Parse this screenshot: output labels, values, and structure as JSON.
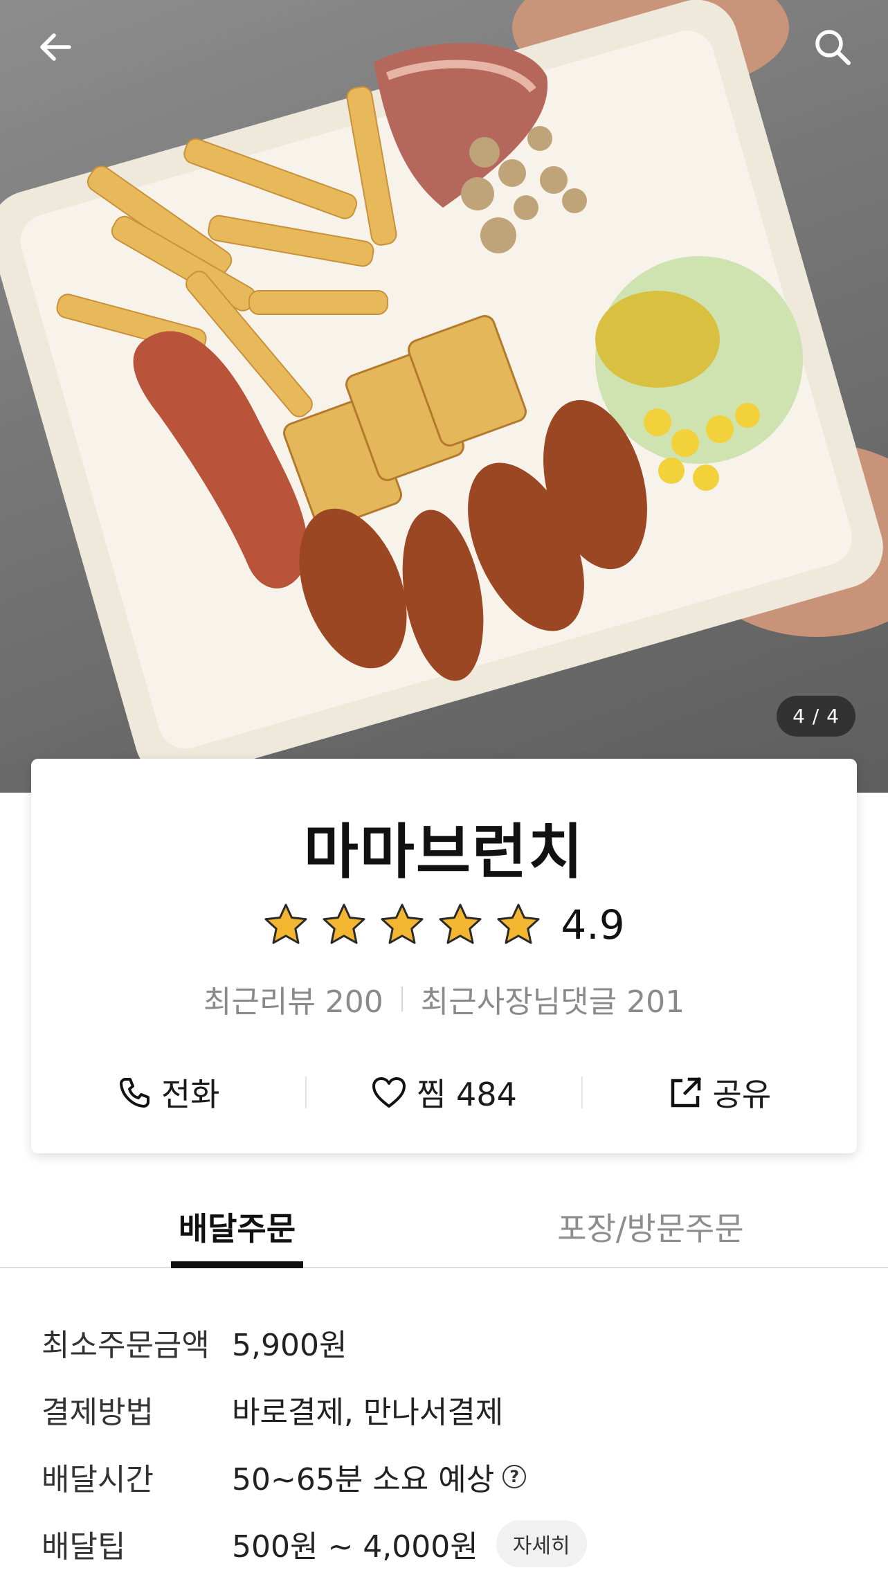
{
  "header": {
    "back_icon": "arrow-left-icon",
    "search_icon": "search-icon"
  },
  "hero": {
    "image_counter": "4 / 4"
  },
  "shop": {
    "name": "마마브런치",
    "rating": 4.9,
    "rating_text": "4.9",
    "stars_total": 5,
    "star_color": "#F2B630",
    "recent_reviews": "최근리뷰 200",
    "owner_replies": "최근사장님댓글 201"
  },
  "actions": {
    "call_label": "전화",
    "like_label": "찜 484",
    "share_label": "공유"
  },
  "tabs": {
    "delivery": "배달주문",
    "pickup": "포장/방문주문",
    "active": "delivery"
  },
  "delivery_info": [
    {
      "label": "최소주문금액",
      "value": "5,900원"
    },
    {
      "label": "결제방법",
      "value": "바로결제, 만나서결제"
    },
    {
      "label": "배달시간",
      "value": "50~65분 소요 예상",
      "help": "?"
    },
    {
      "label": "배달팁",
      "value": "500원 ~ 4,000원",
      "button": "자세히"
    }
  ]
}
